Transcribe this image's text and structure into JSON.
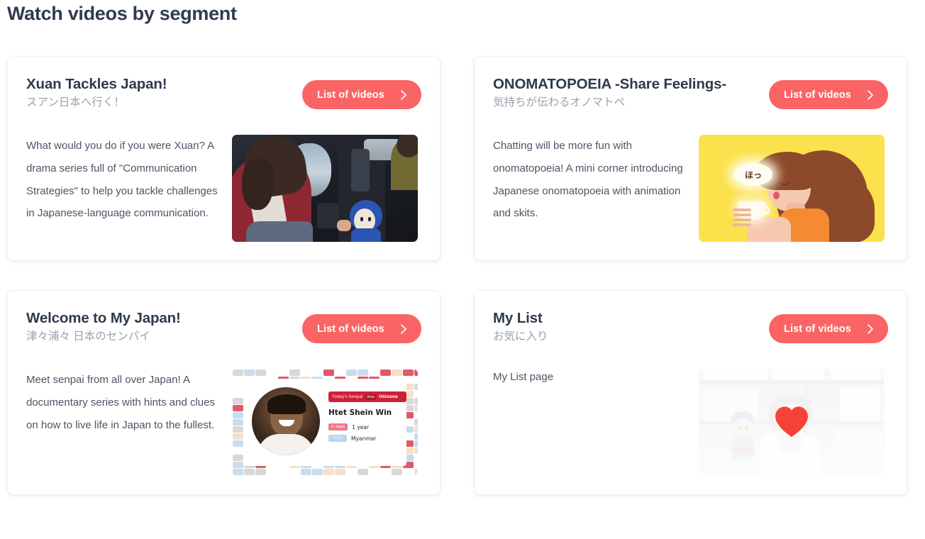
{
  "page": {
    "title": "Watch videos by segment",
    "title_color": "#303b4e",
    "background": "#ffffff",
    "accent_color": "#fb6464"
  },
  "button": {
    "label": "List of videos",
    "icon": "chevron-right-icon"
  },
  "cards": [
    {
      "id": "xuan-tackles-japan",
      "title": "Xuan Tackles Japan!",
      "subtitle": "スアン日本へ行く！",
      "description": "What would you do if you were Xuan? A drama series full of \"Communication Strategies\" to help you tackle challenges in Japanese-language communication.",
      "thumbnail_alt": "drama-scene-airplane-thumbnail"
    },
    {
      "id": "onomatopoeia-share-feelings",
      "title": "ONOMATOPOEIA -Share Feelings-",
      "subtitle": "気持ちが伝わるオノマトペ",
      "description": "Chatting will be more fun with onomatopoeia! A mini corner introducing Japanese onomatopoeia with animation and skits.",
      "thumbnail_alt": "onomatopoeia-illustration-thumbnail",
      "thumbnail_text": "ほっ",
      "thumbnail_bg": "#fbe14c"
    },
    {
      "id": "welcome-to-my-japan",
      "title": "Welcome to My Japan!",
      "subtitle": "津々浦々 日本のセンパイ",
      "description": "Meet senpai from all over Japan! A documentary series with hints and clues on how to live life in Japan to the fullest.",
      "thumbnail_alt": "senpai-profile-card-thumbnail",
      "thumbnail_fields": {
        "header_label": "Today's Senpai",
        "area_label": "Area",
        "area_value": "Okinawa",
        "name": "Htet Shein Win",
        "in_japan_label": "In Japan",
        "in_japan_value": "1 year",
        "from_label": "From",
        "from_value": "Myanmar"
      }
    },
    {
      "id": "my-list",
      "title": "My List",
      "subtitle": "お気に入り",
      "description": "My List page",
      "thumbnail_alt": "my-list-favorites-thumbnail",
      "thumbnail_icon": "heart-icon",
      "thumbnail_icon_color": "#f44336"
    }
  ]
}
